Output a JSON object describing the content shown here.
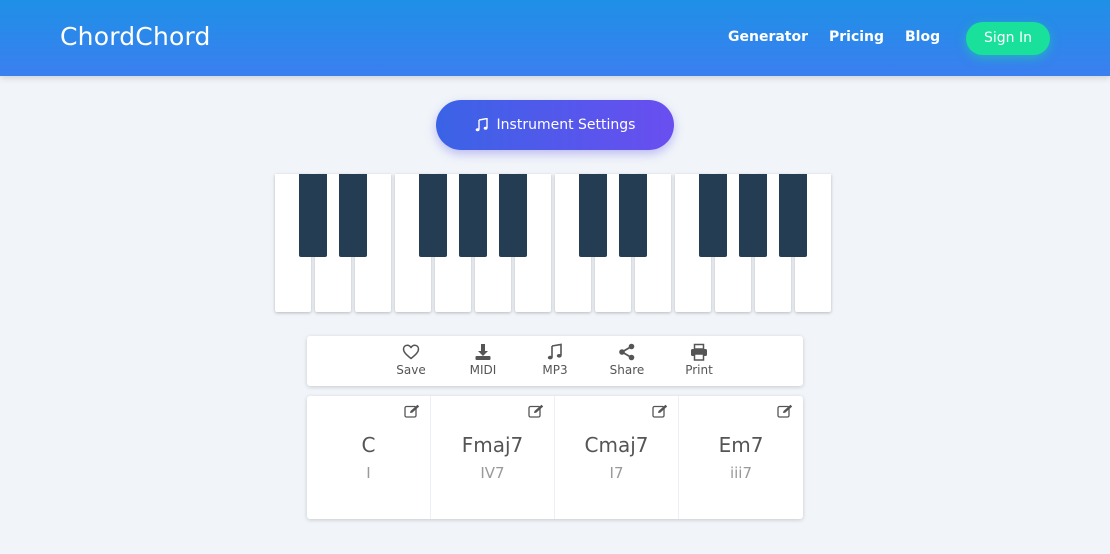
{
  "header": {
    "logo": "ChordChord",
    "nav": [
      {
        "label": "Generator"
      },
      {
        "label": "Pricing"
      },
      {
        "label": "Blog"
      }
    ],
    "signin_label": "Sign In"
  },
  "instrument_button": {
    "label": "Instrument Settings",
    "icon": "music-note-icon"
  },
  "piano": {
    "white_keys": 14,
    "black_keys": 10
  },
  "toolbar": {
    "items": [
      {
        "label": "Save",
        "icon": "heart-icon"
      },
      {
        "label": "MIDI",
        "icon": "download-icon"
      },
      {
        "label": "MP3",
        "icon": "music-note-icon"
      },
      {
        "label": "Share",
        "icon": "share-icon"
      },
      {
        "label": "Print",
        "icon": "print-icon"
      }
    ]
  },
  "chords": [
    {
      "name": "C",
      "roman": "I"
    },
    {
      "name": "Fmaj7",
      "roman": "IV7"
    },
    {
      "name": "Cmaj7",
      "roman": "I7"
    },
    {
      "name": "Em7",
      "roman": "iii7"
    }
  ],
  "colors": {
    "header_start": "#1e90e6",
    "header_end": "#3b7ff0",
    "signin": "#19e09a",
    "instrument_start": "#3a63e6",
    "instrument_end": "#6a4ef0",
    "black_key": "#243d52",
    "background": "#f1f5f9"
  }
}
